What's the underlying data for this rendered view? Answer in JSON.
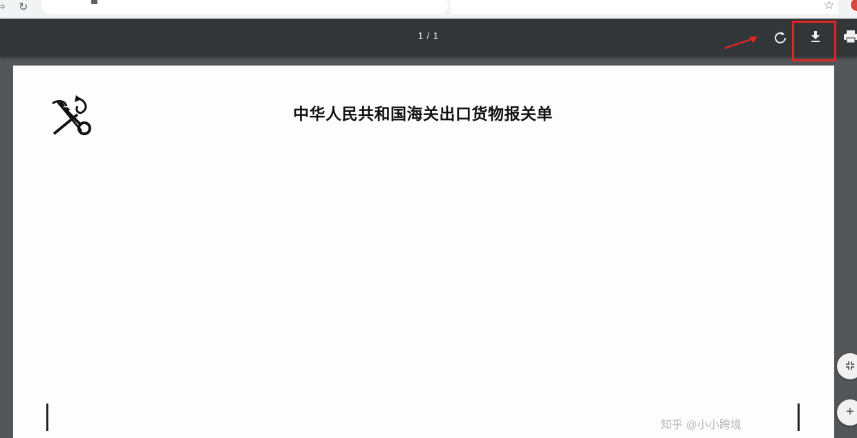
{
  "browser": {
    "forward_icon": "forward-arrow-icon",
    "reload_icon": "reload-icon",
    "lock_icon": "lock-icon",
    "star_icon": "bookmark-star-icon",
    "profile_icon": "profile-avatar-icon"
  },
  "pdf_toolbar": {
    "page_indicator": "1 / 1",
    "rotate_icon": "rotate-icon",
    "download_icon": "download-icon",
    "print_icon": "print-icon",
    "highlight_color": "#e02525"
  },
  "document": {
    "title": "中华人民共和国海关出口货物报关单",
    "emblem_icon": "customs-emblem-icon",
    "watermark_text": "知乎 @小小跨境"
  },
  "zoom_controls": {
    "fit_icon": "fit-to-page-icon",
    "zoom_in_label": "+"
  },
  "colors": {
    "toolbar_bg": "#323639",
    "viewer_bg": "#525659",
    "annotation_red": "#e02525"
  }
}
